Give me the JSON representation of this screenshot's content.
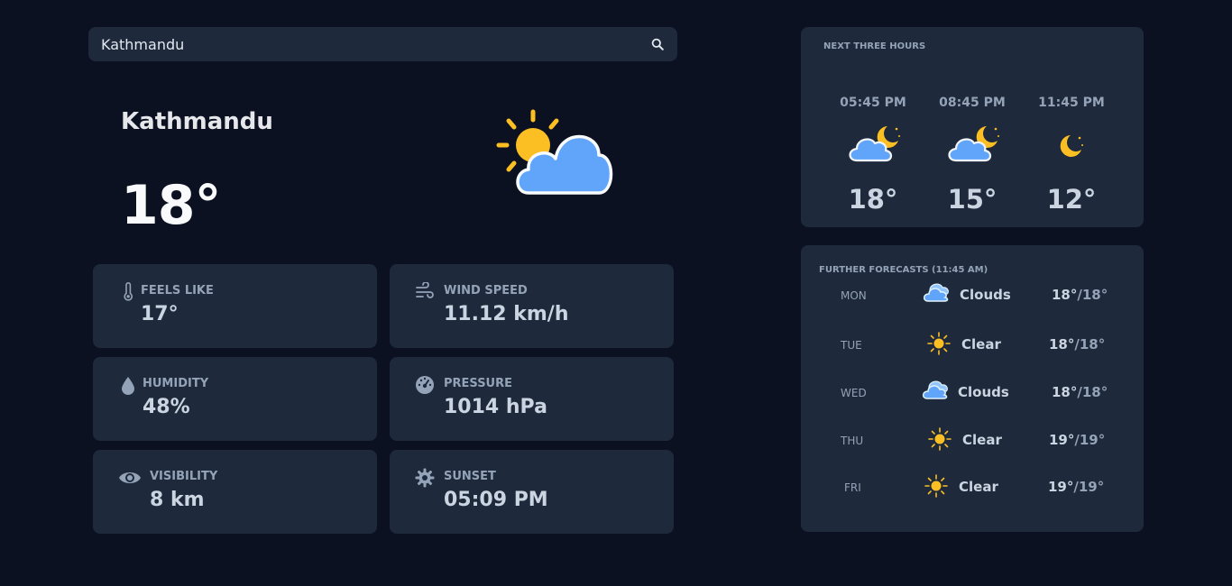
{
  "search": {
    "value": "Kathmandu",
    "icon": "search-icon"
  },
  "current": {
    "city": "Kathmandu",
    "temperature": "18°",
    "icon": "partly-cloudy-day-icon"
  },
  "details": [
    {
      "label": "FEELS LIKE",
      "value": "17°",
      "icon": "thermometer-icon"
    },
    {
      "label": "WIND SPEED",
      "value": "11.12 km/h",
      "icon": "wind-icon"
    },
    {
      "label": "HUMIDITY",
      "value": "48%",
      "icon": "droplet-icon"
    },
    {
      "label": "PRESSURE",
      "value": "1014 hPa",
      "icon": "gauge-icon"
    },
    {
      "label": "VISIBILITY",
      "value": "8 km",
      "icon": "eye-icon"
    },
    {
      "label": "SUNSET",
      "value": "05:09 PM",
      "icon": "sun-gear-icon"
    }
  ],
  "next_hours": {
    "title": "NEXT THREE HOURS",
    "items": [
      {
        "time": "05:45 PM",
        "temp": "18°",
        "icon": "partly-cloudy-night-icon"
      },
      {
        "time": "08:45 PM",
        "temp": "15°",
        "icon": "partly-cloudy-night-icon"
      },
      {
        "time": "11:45 PM",
        "temp": "12°",
        "icon": "clear-night-icon"
      }
    ]
  },
  "forecast": {
    "title": "FURTHER FORECASTS (11:45 AM)",
    "days": [
      {
        "day": "MON",
        "condition": "Clouds",
        "high": "18°",
        "low": "/18°",
        "icon": "clouds-icon"
      },
      {
        "day": "TUE",
        "condition": "Clear",
        "high": "18°",
        "low": "/18°",
        "icon": "sun-icon"
      },
      {
        "day": "WED",
        "condition": "Clouds",
        "high": "18°",
        "low": "/18°",
        "icon": "clouds-icon"
      },
      {
        "day": "THU",
        "condition": "Clear",
        "high": "19°",
        "low": "/19°",
        "icon": "sun-icon"
      },
      {
        "day": "FRI",
        "condition": "Clear",
        "high": "19°",
        "low": "/19°",
        "icon": "sun-icon"
      }
    ]
  },
  "colors": {
    "background": "#0b1120",
    "card": "#1e293b",
    "sun": "#fbbf24",
    "cloud": "#60a5fa"
  }
}
